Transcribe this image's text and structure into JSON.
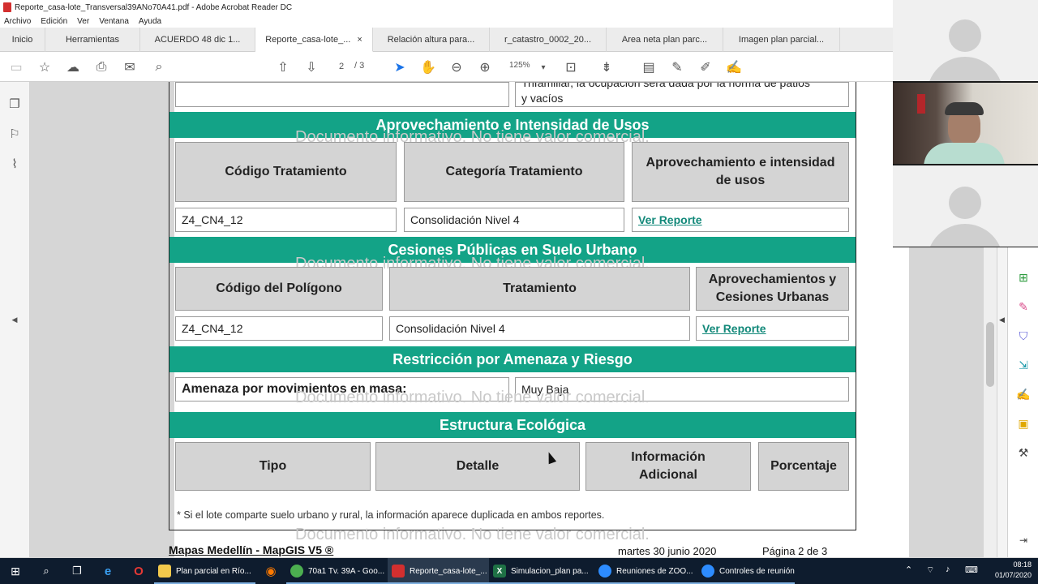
{
  "window": {
    "title": "Reporte_casa-lote_Transversal39ANo70A41.pdf - Adobe Acrobat Reader DC"
  },
  "menu": [
    "Archivo",
    "Edición",
    "Ver",
    "Ventana",
    "Ayuda"
  ],
  "tabs": [
    {
      "label": "Inicio"
    },
    {
      "label": "Herramientas"
    },
    {
      "label": "ACUERDO 48 dic 1..."
    },
    {
      "label": "Reporte_casa-lote_...",
      "close": "×"
    },
    {
      "label": "Relación altura para..."
    },
    {
      "label": "r_catastro_0002_20..."
    },
    {
      "label": "Area neta plan parc..."
    },
    {
      "label": "Imagen plan parcial..."
    }
  ],
  "toolbar": {
    "page_current": "2",
    "page_total": "/ 3",
    "zoom": "125%"
  },
  "report": {
    "top_remnant_line1": "Trifamiliar, la ocupación será dada por la norma de patios",
    "top_remnant_line2": "y vacíos",
    "watermark": "Documento informativo. No tiene valor comercial.",
    "sections": {
      "aprovechamiento": {
        "title": "Aprovechamiento e Intensidad de Usos",
        "headers": [
          "Código Tratamiento",
          "Categoría Tratamiento",
          "Aprovechamiento e intensidad de usos"
        ],
        "row": [
          "Z4_CN4_12",
          "Consolidación Nivel 4",
          "Ver Reporte"
        ]
      },
      "cesiones": {
        "title": "Cesiones Públicas en Suelo Urbano",
        "headers": [
          "Código del Polígono",
          "Tratamiento",
          "Aprovechamientos y Cesiones Urbanas"
        ],
        "row": [
          "Z4_CN4_12",
          "Consolidación Nivel 4",
          "Ver Reporte"
        ]
      },
      "restriccion": {
        "title": "Restricción por Amenaza y Riesgo",
        "label": "Amenaza por movimientos en masa:",
        "value": "Muy Baja"
      },
      "estructura": {
        "title": "Estructura Ecológica",
        "headers": [
          "Tipo",
          "Detalle",
          "Información Adicional",
          "Porcentaje"
        ]
      }
    },
    "footnote": "* Si el lote comparte suelo urbano y rural,  la información aparece duplicada en ambos reportes.",
    "footer": {
      "brand": "Mapas Medellín - MapGIS V5 ®",
      "date": "martes 30 junio 2020",
      "page": "Página 2 de 3"
    }
  },
  "taskbar": {
    "apps": [
      {
        "label": "Plan parcial en Río...",
        "color": "#f2c94c"
      },
      {
        "label": "70a1 Tv. 39A - Goo...",
        "color": "#4caf50"
      },
      {
        "label": "Reporte_casa-lote_...",
        "color": "#d32f2f"
      },
      {
        "label": "Simulacion_plan pa...",
        "color": "#1e7145"
      },
      {
        "label": "Reuniones de ZOO...",
        "color": "#2d8cff"
      },
      {
        "label": "Controles de reunión",
        "color": "#2d8cff"
      }
    ],
    "time": "08:18",
    "date": "01/07/2020"
  }
}
